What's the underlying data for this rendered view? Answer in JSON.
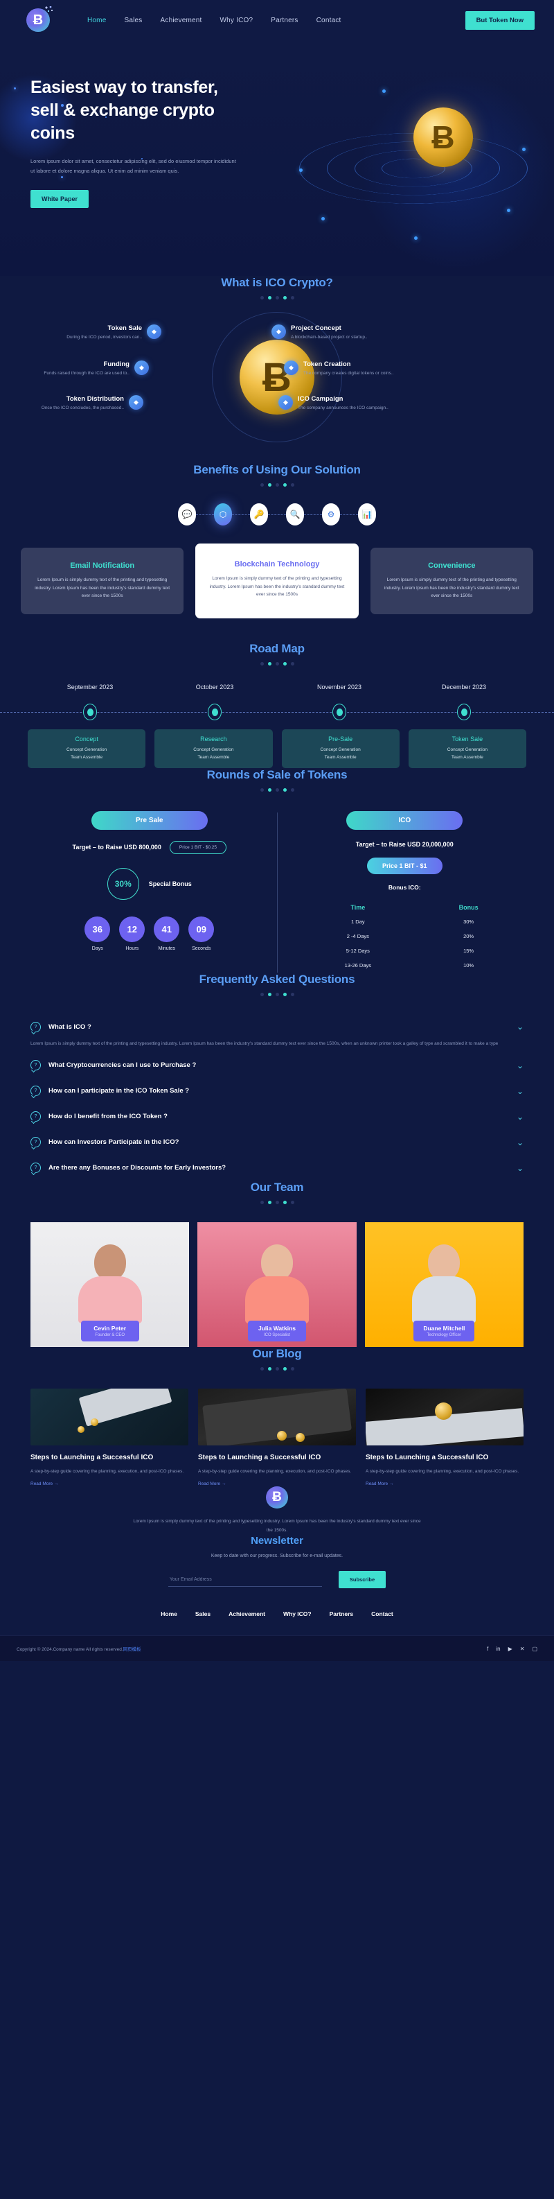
{
  "brand": {
    "logo_glyph": "Ƀ",
    "logo_name": "bitcoin-logo"
  },
  "header": {
    "nav": [
      {
        "label": "Home",
        "active": true
      },
      {
        "label": "Sales",
        "active": false
      },
      {
        "label": "Achievement",
        "active": false
      },
      {
        "label": "Why ICO?",
        "active": false
      },
      {
        "label": "Partners",
        "active": false
      },
      {
        "label": "Contact",
        "active": false
      }
    ],
    "cta_label": "But Token Now"
  },
  "hero": {
    "title_line1": "Easiest way to transfer,",
    "title_line2": "sell & exchange crypto",
    "title_line3": "coins",
    "paragraph": "Lorem ipsum dolor sit amet, consectetur adipiscing elit, sed do eiusmod tempor incididunt ut labore et dolore magna aliqua. Ut enim ad minim veniam quis.",
    "cta_label": "White Paper"
  },
  "what_is_ico": {
    "title": "What is ICO Crypto?",
    "items": [
      {
        "heading": "Token Sale",
        "desc": "During the ICO period, investors can..",
        "icon": "token-sale-icon",
        "side": "left"
      },
      {
        "heading": "Funding",
        "desc": "Funds raised through the ICO are used to..",
        "icon": "funding-icon",
        "side": "left"
      },
      {
        "heading": "Token Distribution",
        "desc": "Once the ICO concludes, the purchased..",
        "icon": "token-distribution-icon",
        "side": "left"
      },
      {
        "heading": "Project Concept",
        "desc": "A blockchain-based project or startup..",
        "icon": "project-concept-icon",
        "side": "right"
      },
      {
        "heading": "Token Creation",
        "desc": "The company creates digital tokens or coins..",
        "icon": "token-creation-icon",
        "side": "right"
      },
      {
        "heading": "ICO Campaign",
        "desc": "The company announces the ICO campaign..",
        "icon": "ico-campaign-icon",
        "side": "right"
      }
    ]
  },
  "benefits": {
    "title": "Benefits of Using Our Solution",
    "icons": [
      {
        "name": "chat-notification-icon",
        "glyph": "💬",
        "active": false
      },
      {
        "name": "blockchain-cube-icon",
        "glyph": "⬡",
        "active": true
      },
      {
        "name": "person-key-icon",
        "glyph": "🔑",
        "active": false
      },
      {
        "name": "search-analytics-icon",
        "glyph": "🔍",
        "active": false
      },
      {
        "name": "network-share-icon",
        "glyph": "⚙",
        "active": false
      },
      {
        "name": "bar-chart-icon",
        "glyph": "📊",
        "active": false
      }
    ],
    "cards": [
      {
        "title": "Email Notification",
        "text": "Lorem Ipsum is simply dummy text of the printing and typesetting industry. Lorem Ipsum has been the industry's standard dummy text ever since the 1500s",
        "featured": false
      },
      {
        "title": "Blockchain Technology",
        "text": "Lorem Ipsum is simply dummy text of the printing and typesetting industry. Lorem Ipsum has been the industry's standard dummy text ever since the 1500s",
        "featured": true
      },
      {
        "title": "Convenience",
        "text": "Lorem Ipsum is simply dummy text of the printing and typesetting industry. Lorem Ipsum has been the industry's standard dummy text ever since the 1500s",
        "featured": false
      }
    ]
  },
  "roadmap": {
    "title": "Road Map",
    "months": [
      "September 2023",
      "October 2023",
      "November 2023",
      "December 2023"
    ],
    "cards": [
      {
        "title": "Concept",
        "line1": "Concept Generation",
        "line2": "Team Assemble"
      },
      {
        "title": "Research",
        "line1": "Concept Generation",
        "line2": "Team Assemble"
      },
      {
        "title": "Pre-Sale",
        "line1": "Concept Generation",
        "line2": "Team Assemble"
      },
      {
        "title": "Token Sale",
        "line1": "Concept Generation",
        "line2": "Team Assemble"
      }
    ]
  },
  "rounds": {
    "title": "Rounds of Sale of Tokens",
    "presale": {
      "tab_label": "Pre Sale",
      "target": "Target – to Raise USD 800,000",
      "price": "Price 1 BIT - $0.25",
      "bonus_pct": "30%",
      "bonus_label": "Special Bonus",
      "countdown": [
        {
          "value": "36",
          "unit": "Days"
        },
        {
          "value": "12",
          "unit": "Hours"
        },
        {
          "value": "41",
          "unit": "Minutes"
        },
        {
          "value": "09",
          "unit": "Seconds"
        }
      ]
    },
    "ico": {
      "tab_label": "ICO",
      "target": "Target – to Raise USD 20,000,000",
      "price": "Price 1 BIT - $1",
      "bonus_heading": "Bonus ICO:",
      "table_headers": [
        "Time",
        "Bonus"
      ],
      "table_rows": [
        [
          "1 Day",
          "30%"
        ],
        [
          "2 -4 Days",
          "20%"
        ],
        [
          "5-12 Days",
          "15%"
        ],
        [
          "13-26 Days",
          "10%"
        ]
      ]
    }
  },
  "faq": {
    "title": "Frequently Asked Questions",
    "items": [
      {
        "q": "What is ICO ?",
        "a": "Lorem Ipsum is simply dummy text of the printing and typesetting industry. Lorem Ipsum has been the industry's standard dummy text ever since the 1500s, when an unknown printer took a galley of type and scrambled it to make a type",
        "open": true
      },
      {
        "q": "What Cryptocurrencies can I use to Purchase ?",
        "a": "",
        "open": false
      },
      {
        "q": "How can I participate in the ICO Token Sale ?",
        "a": "",
        "open": false
      },
      {
        "q": "How do I benefit from the ICO Token ?",
        "a": "",
        "open": false
      },
      {
        "q": "How can Investors Participate in the ICO?",
        "a": "",
        "open": false
      },
      {
        "q": "Are there any Bonuses or Discounts for Early Investors?",
        "a": "",
        "open": false
      }
    ]
  },
  "team": {
    "title": "Our Team",
    "members": [
      {
        "name": "Cevin Peter",
        "role": "Founder & CEO"
      },
      {
        "name": "Julia Watkins",
        "role": "ICO Specialist"
      },
      {
        "name": "Duane Mitchell",
        "role": "Technology Officer"
      }
    ]
  },
  "blog": {
    "title": "Our Blog",
    "posts": [
      {
        "title": "Steps to Launching a Successful ICO",
        "excerpt": "A step-by-step guide covering the planning, execution, and post-ICO phases.",
        "link_label": "Read More"
      },
      {
        "title": "Steps to Launching a Successful ICO",
        "excerpt": "A step-by-step guide covering the planning, execution, and post-ICO phases.",
        "link_label": "Read More"
      },
      {
        "title": "Steps to Launching a Successful ICO",
        "excerpt": "A step-by-step guide covering the planning, execution, and post-ICO phases.",
        "link_label": "Read More"
      }
    ]
  },
  "footer": {
    "about": "Lorem Ipsum is simply dummy text of the printing and typesetting industry. Lorem Ipsum has been the industry's standard dummy text ever since the 1500s.",
    "newsletter": {
      "title": "Newsletter",
      "subtitle": "Keep to date with our progress. Subscribe for e-mail updates.",
      "placeholder": "Your Email Address",
      "value": "",
      "button": "Subscribe"
    },
    "nav": [
      "Home",
      "Sales",
      "Achievement",
      "Why ICO?",
      "Partners",
      "Contact"
    ],
    "copyright": "Copyright © 2024.Company name All rights reserved.",
    "copyright_link": "网页模板",
    "socials": [
      {
        "name": "facebook-icon",
        "glyph": "f"
      },
      {
        "name": "linkedin-icon",
        "glyph": "in"
      },
      {
        "name": "youtube-icon",
        "glyph": "▶"
      },
      {
        "name": "x-twitter-icon",
        "glyph": "✕"
      },
      {
        "name": "instagram-icon",
        "glyph": "▢"
      }
    ]
  },
  "colors": {
    "bg": "#0f1941",
    "accent_teal": "#3fe0d0",
    "accent_blue": "#5b9ef5",
    "accent_purple": "#6d62f0"
  }
}
